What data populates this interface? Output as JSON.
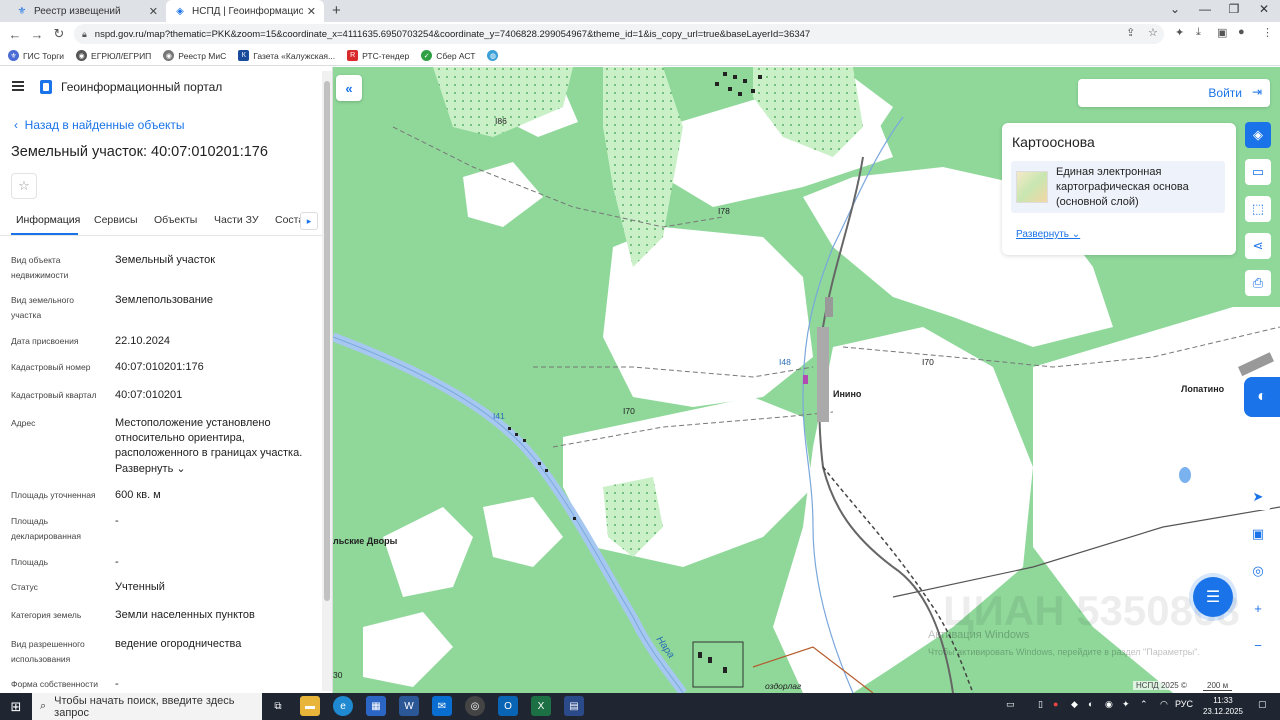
{
  "browser": {
    "tabs": [
      {
        "title": "Реестр извещений",
        "close": "✕"
      },
      {
        "title": "НСПД | Геоинформационный п",
        "close": "✕"
      }
    ],
    "new_tab": "+",
    "window_controls": [
      "⌄",
      "—",
      "❐",
      "✕"
    ],
    "url": "nspd.gov.ru/map?thematic=PKK&zoom=15&coordinate_x=4111635.6950703254&coordinate_y=7406828.299054967&theme_id=1&is_copy_url=true&baseLayerId=36347",
    "bookmarks": [
      {
        "label": "ГИС Торги",
        "color": "#4a6cd4"
      },
      {
        "label": "ЕГРЮЛ/ЕГРИП",
        "color": "#555555"
      },
      {
        "label": "Реестр МиС",
        "color": "#777777"
      },
      {
        "label": "Газета «Калужская...",
        "color": "#1a4a9a"
      },
      {
        "label": "РТС-тендер",
        "color": "#d92b2b"
      },
      {
        "label": "Сбер АСТ",
        "color": "#2ea043"
      },
      {
        "label": "",
        "color": "#3aa0d8"
      }
    ]
  },
  "panel": {
    "portal_title": "Геоинформационный портал",
    "back_label": "Назад в найденные объекты",
    "object_title": "Земельный участок: 40:07:010201:176",
    "tabs": [
      "Информация",
      "Сервисы",
      "Объекты",
      "Части ЗУ",
      "Соста"
    ],
    "fields": [
      {
        "label": "Вид объекта недвижимости",
        "value": "Земельный участок"
      },
      {
        "label": "Вид земельного участка",
        "value": "Землепользование"
      },
      {
        "label": "Дата присвоения",
        "value": "22.10.2024"
      },
      {
        "label": "Кадастровый номер",
        "value": "40:07:010201:176"
      },
      {
        "label": "Кадастровый квартал",
        "value": "40:07:010201"
      },
      {
        "label": "Адрес",
        "value": "Местоположение установлено относительно ориентира, расположенного в границах участка."
      },
      {
        "label": "Площадь уточненная",
        "value": "600 кв. м"
      },
      {
        "label": "Площадь декларированная",
        "value": "-"
      },
      {
        "label": "Площадь",
        "value": "-"
      },
      {
        "label": "Статус",
        "value": "Учтенный"
      },
      {
        "label": "Категория земель",
        "value": "Земли населенных пунктов"
      },
      {
        "label": "Вид разрешенного использования",
        "value": "ведение огородничества"
      },
      {
        "label": "Форма собственности",
        "value": "-"
      }
    ],
    "expand_label": "Развернуть"
  },
  "map": {
    "login_label": "Войти",
    "basemap": {
      "title": "Картооснова",
      "item": "Единая электронная картографическая основа (основной слой)",
      "expand": "Развернуть"
    },
    "labels": {
      "village_inino": "Инино",
      "village_lopatino": "Лопатино",
      "dvory": "льские Дворы",
      "river": "Нара",
      "ozdor": "оздорлаг",
      "h186": "I86",
      "h178": "I78",
      "h170a": "I70",
      "h170b": "I70",
      "h141": "I41",
      "h148": "I48",
      "edge30": "30"
    },
    "watermark_line1": "Активация Windows",
    "watermark_line2": "Чтобы активировать Windows, перейдите в раздел \"Параметры\".",
    "cian": "ЦИАН 5350868",
    "attribution": "НСПД 2025 ©",
    "scale": "200 м",
    "colors": {
      "forest": "#8fd89a",
      "water": "#a6c8f0",
      "road": "#555555",
      "accent": "#1a73e8"
    }
  },
  "taskbar": {
    "search_placeholder": "Чтобы начать поиск, введите здесь запрос",
    "lang": "РУС",
    "time": "11:33",
    "date": "23.12.2025"
  }
}
